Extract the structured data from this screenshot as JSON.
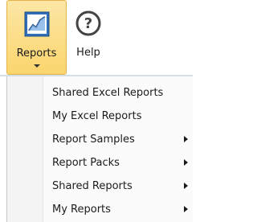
{
  "ribbon": {
    "reports_button": {
      "label": "Reports",
      "icon": "chart-icon"
    },
    "help_button": {
      "label": "Help",
      "icon": "question-circle-icon"
    }
  },
  "menu": {
    "items": [
      {
        "label": "Shared Excel Reports",
        "has_submenu": false
      },
      {
        "label": "My Excel Reports",
        "has_submenu": false
      },
      {
        "label": "Report Samples",
        "has_submenu": true
      },
      {
        "label": "Report Packs",
        "has_submenu": true
      },
      {
        "label": "Shared Reports",
        "has_submenu": true
      },
      {
        "label": "My Reports",
        "has_submenu": true
      }
    ]
  },
  "colors": {
    "active_button_bg": "#fbd56d",
    "active_button_border": "#e5b44b",
    "menu_bg": "#fbfbfb",
    "gutter_bg": "#f3f3f3"
  }
}
